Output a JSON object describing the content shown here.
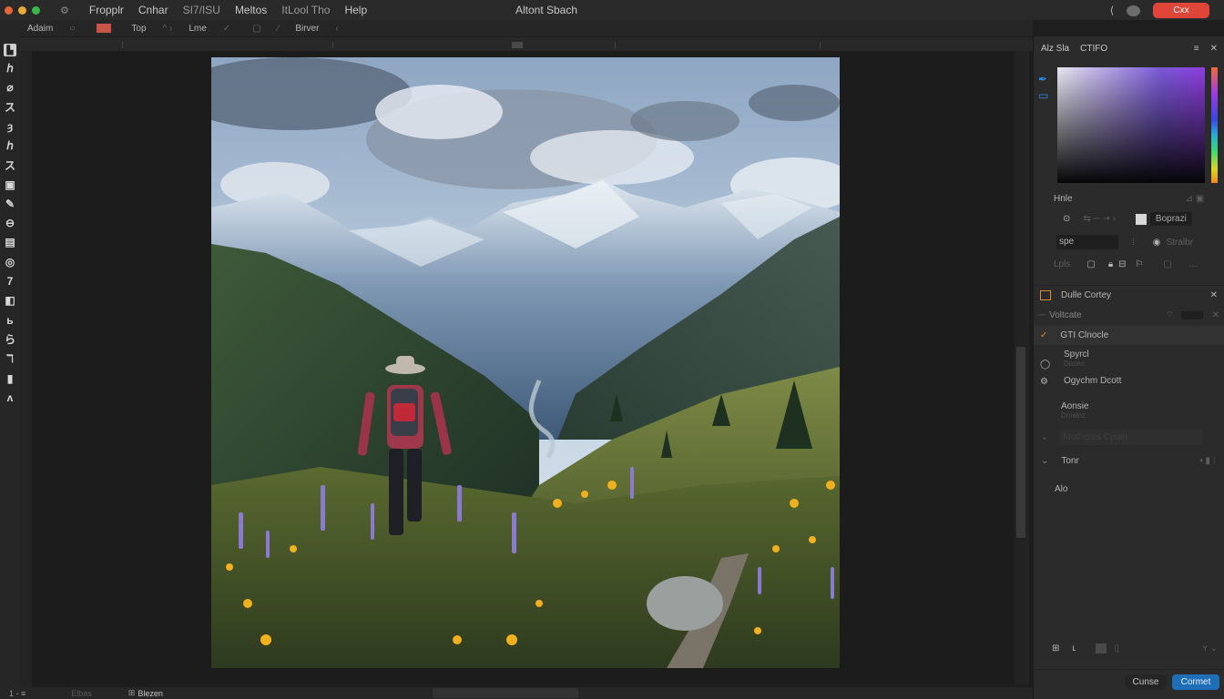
{
  "titlebar": {
    "traffic_colors": [
      "#e8643a",
      "#e8a83a",
      "#3ab84a"
    ],
    "menu": [
      "Fropplr",
      "Cnhar",
      "SI7/ISU",
      "Meltos",
      "ItLool Tho",
      "Help"
    ],
    "window_title": "Altont Sbach",
    "red_button_label": "Cxx"
  },
  "options_bar": {
    "items": [
      "Adaim",
      "Top",
      "Lme",
      "Birver"
    ],
    "swatch_color": "#c7554a"
  },
  "toolbar": {
    "tools": [
      "move",
      "lasso",
      "quick-select",
      "crop",
      "eyedropper",
      "heal",
      "brush",
      "clone",
      "history",
      "eraser",
      "gradient",
      "blur",
      "dodge",
      "pen",
      "type",
      "path-select",
      "shape",
      "hand",
      "zoom"
    ]
  },
  "status": {
    "zoom": "1 - ≡",
    "doc": "Elbas",
    "tab": "Blezen"
  },
  "panel": {
    "tab1": "Alz Sla",
    "tab2": "CTIFO",
    "picker_label": "Hnle",
    "swatch_label": "Boprazi",
    "field_label": "spe",
    "toggle_label": "Stralbr",
    "lock_label": "Lpls",
    "section2_title": "Dulle Cortey",
    "section2_sub": "Voltcate",
    "active_item": "GTI Clnocle",
    "items": [
      {
        "title": "Spyrcl",
        "sub": "Daseo"
      },
      {
        "title": "Ogychm Dcott",
        "sub": ""
      },
      {
        "title": "Aonsie",
        "sub": "Dmelnz"
      }
    ],
    "collapsed_item": "Motheres  Cpuin",
    "tonr_label": "Tonr",
    "alo_label": "Alo",
    "cancel_label": "Cunse",
    "commit_label": "Cormet"
  }
}
